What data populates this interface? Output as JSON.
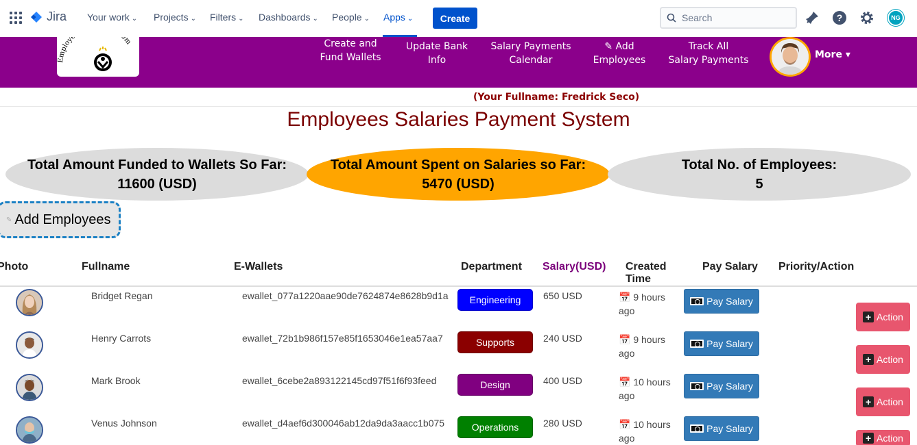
{
  "jira": {
    "brand": "Jira",
    "nav": [
      {
        "label": "Your work"
      },
      {
        "label": "Projects"
      },
      {
        "label": "Filters"
      },
      {
        "label": "Dashboards"
      },
      {
        "label": "People"
      },
      {
        "label": "Apps"
      }
    ],
    "active_nav": "Apps",
    "create_label": "Create",
    "search_placeholder": "Search",
    "user_initials": "NG",
    "icons": [
      "apps-grid-icon",
      "notifications-icon",
      "help-icon",
      "settings-icon"
    ]
  },
  "app": {
    "logo_text": "Employees Salary System",
    "menu": [
      {
        "line1": "Create and",
        "line2": "Fund Wallets"
      },
      {
        "line1": "Update Bank",
        "line2": "Info"
      },
      {
        "line1": "Salary Payments",
        "line2": "Calendar"
      },
      {
        "line1": "✎ Add",
        "line2": "Employees"
      },
      {
        "line1": "Track All",
        "line2": "Salary Payments"
      }
    ],
    "more_label": "More ▾",
    "fullname_line": "(Your Fullname: Fredrick Seco)",
    "page_title": "Employees Salaries Payment System",
    "colors": {
      "header": "#8b008b",
      "accent": "#ffa500",
      "title": "#7b0000"
    }
  },
  "stats": [
    {
      "label": "Total Amount Funded to Wallets So Far:",
      "value": "11600 (USD)"
    },
    {
      "label": "Total Amount Spent on Salaries so Far:",
      "value": "5470 (USD)"
    },
    {
      "label": "Total No. of Employees:",
      "value": "5"
    }
  ],
  "add_employees_label": "Add Employees",
  "table": {
    "headers": {
      "photo": "Photo",
      "fullname": "Fullname",
      "ewallets": "E-Wallets",
      "department": "Department",
      "salary": "Salary(USD)",
      "created_line1": "Created",
      "created_line2": "Time",
      "pay": "Pay Salary",
      "priority": "Priority/Action"
    },
    "rows": [
      {
        "name": "Bridget Regan",
        "wallet": "ewallet_077a1220aae90de7624874e8628b9d1a",
        "department": "Engineering",
        "dept_color": "#0000ff",
        "salary": "650 USD",
        "time_line1": "9 hours",
        "time_line2": "ago",
        "pay_label": "Pay Salary",
        "action_label": "Action"
      },
      {
        "name": "Henry Carrots",
        "wallet": "ewallet_72b1b986f157e85f1653046e1ea57aa7",
        "department": "Supports",
        "dept_color": "#8b0000",
        "salary": "240 USD",
        "time_line1": "9 hours",
        "time_line2": "ago",
        "pay_label": "Pay Salary",
        "action_label": "Action"
      },
      {
        "name": "Mark Brook",
        "wallet": "ewallet_6cebe2a893122145cd97f51f6f93feed",
        "department": "Design",
        "dept_color": "#800080",
        "salary": "400 USD",
        "time_line1": "10 hours",
        "time_line2": "ago",
        "pay_label": "Pay Salary",
        "action_label": "Action"
      },
      {
        "name": "Venus Johnson",
        "wallet": "ewallet_d4aef6d300046ab12da9da3aacc1b075",
        "department": "Operations",
        "dept_color": "#008000",
        "salary": "280 USD",
        "time_line1": "10 hours",
        "time_line2": "ago",
        "pay_label": "Pay Salary",
        "action_label": "Action"
      }
    ]
  }
}
